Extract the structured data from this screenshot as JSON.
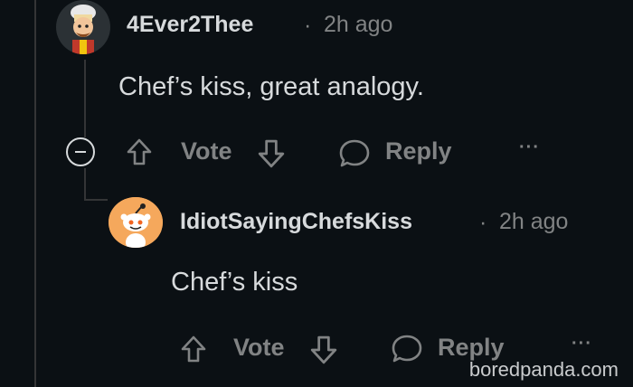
{
  "comment": {
    "username": "4Ever2Thee",
    "separator": "·",
    "time": "2h ago",
    "text": "Chef’s kiss, great analogy.",
    "vote_label": "Vote",
    "reply_label": "Reply",
    "more_label": "···"
  },
  "reply": {
    "username": "IdiotSayingChefsKiss",
    "separator": "·",
    "time": "2h ago",
    "text": "Chef’s kiss",
    "vote_label": "Vote",
    "reply_label": "Reply",
    "more_label": "···"
  },
  "watermark": "boredpanda.com",
  "colors": {
    "background": "#0b1014",
    "text": "#d7dadc",
    "muted": "#818384",
    "thread_line": "#343536",
    "reply_avatar_bg": "#f5a85c"
  }
}
